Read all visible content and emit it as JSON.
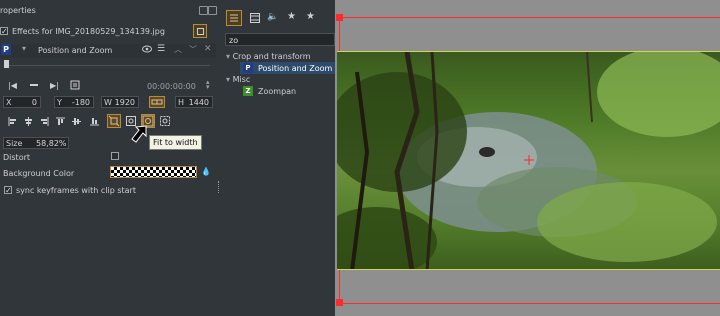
{
  "properties_panel": {
    "title": "roperties",
    "effects_label": "Effects for IMG_20180529_134139.jpg",
    "effect_name": "Position and Zoom",
    "effect_badge": "P",
    "timecode": "00:00:00:00",
    "x_label": "X",
    "x_value": "0",
    "y_label": "Y",
    "y_value": "-180",
    "w_label": "W",
    "w_value": "1920",
    "h_label": "H",
    "h_value": "1440",
    "size_label": "Size",
    "size_value": "58,82%",
    "distort_label": "Distort",
    "background_color_label": "Background Color",
    "sync_label": "sync keyframes with clip start",
    "tooltip": "Fit to width"
  },
  "effects_browser": {
    "search_value": "zo",
    "categories": [
      {
        "name": "Crop and transform",
        "items": [
          {
            "badge": "P",
            "label": "Position and Zoom",
            "selected": true
          }
        ]
      },
      {
        "name": "Misc",
        "items": [
          {
            "badge": "Z",
            "label": "Zoompan",
            "selected": false
          }
        ]
      }
    ]
  },
  "colors": {
    "accent_orange": "#b88b3a",
    "badge_blue": "#1f3d8a",
    "badge_green": "#3c8f2a",
    "selection_blue": "#2c4a6a",
    "monitor_border_red": "#ff2a2a",
    "monitor_frame_yellow": "#d7d25a"
  },
  "icons": {
    "tab_icons": [
      "list-icon",
      "film-icon",
      "audio-icon",
      "star-icon",
      "star-icon"
    ]
  }
}
